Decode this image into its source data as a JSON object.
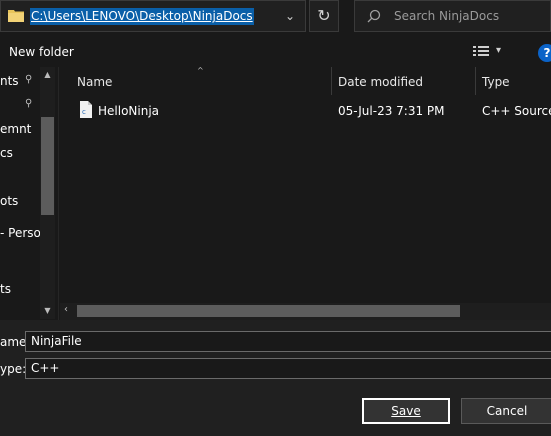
{
  "address_bar": {
    "path": "C:\\Users\\LENOVO\\Desktop\\NinjaDocs",
    "dropdown_icon": "chevron-down-icon"
  },
  "refresh": {
    "icon": "refresh-icon",
    "glyph": "↻"
  },
  "search": {
    "placeholder": "Search NinjaDocs",
    "icon": "search-icon"
  },
  "toolbar": {
    "new_folder_label": "New folder",
    "view_caret": "▾",
    "help_glyph": "?"
  },
  "nav": {
    "items": [
      {
        "label": "nts"
      },
      {
        "label": ""
      },
      {
        "label": "emnt"
      },
      {
        "label": "cs"
      },
      {
        "label": "ots"
      },
      {
        "label": "- Persor"
      },
      {
        "label": "ts"
      }
    ],
    "pin_glyph": "⚲",
    "scroll_up": "▲",
    "scroll_down": "▼"
  },
  "list": {
    "columns": {
      "name": "Name",
      "date": "Date modified",
      "type": "Type"
    },
    "sort_caret": "^",
    "rows": [
      {
        "name": "HelloNinja",
        "date": "05-Jul-23 7:31 PM",
        "type": "C++ Source F"
      }
    ]
  },
  "hscroll": {
    "left_arrow": "‹"
  },
  "form": {
    "filename_label": "ame:",
    "filename_value": "NinjaFile",
    "type_label": "ype:",
    "type_value": "C++"
  },
  "buttons": {
    "save": "Save",
    "cancel": "Cancel"
  },
  "colors": {
    "background": "#191919",
    "selection": "#0a5fa8",
    "help": "#0b63c8",
    "folder": "#e8c45a"
  }
}
